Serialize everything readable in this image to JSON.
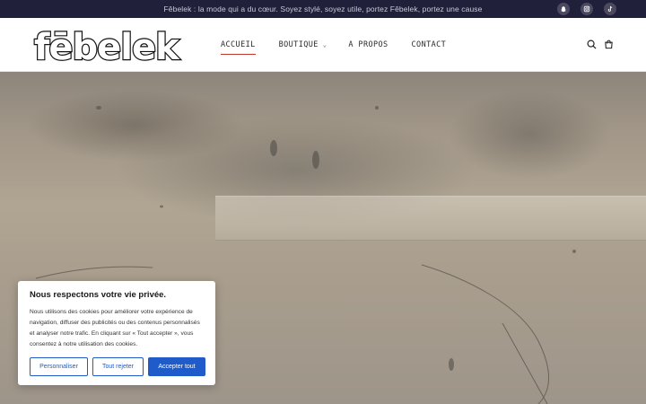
{
  "topbar": {
    "text": "Fêbelek : la mode qui a du cœur. Soyez stylé, soyez utile, portez Fêbelek, portez une cause",
    "social_icons": [
      "snapchat-icon",
      "instagram-icon",
      "tiktok-icon"
    ]
  },
  "logo": {
    "text": "fēbelek"
  },
  "nav": {
    "items": [
      {
        "label": "ACCUEIL",
        "active": true
      },
      {
        "label": "BOUTIQUE",
        "has_dropdown": true
      },
      {
        "label": "A PROPOS"
      },
      {
        "label": "CONTACT"
      }
    ]
  },
  "header_icons": [
    "search-icon",
    "cart-icon"
  ],
  "cookie": {
    "title": "Nous respectons votre vie privée.",
    "text": "Nous utilisons des cookies pour améliorer votre expérience de navigation, diffuser des publicités ou des contenus personnalisés et analyser notre trafic. En cliquant sur « Tout accepter », vous consentez à notre utilisation des cookies.",
    "customize_label": "Personnaliser",
    "reject_label": "Tout rejeter",
    "accept_label": "Accepter tout"
  },
  "colors": {
    "topbar_bg": "#21203a",
    "accent": "#c0392b",
    "button_blue": "#1f5bc9"
  }
}
